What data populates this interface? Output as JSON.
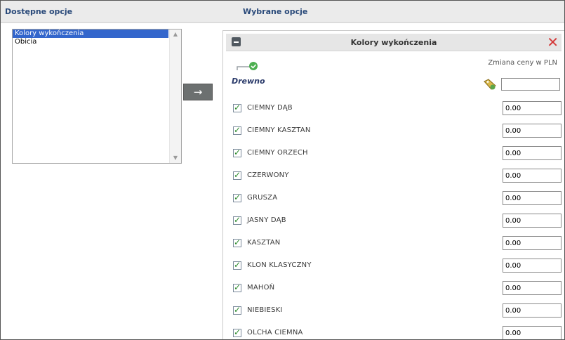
{
  "available": {
    "title": "Dostępne opcje",
    "items": [
      {
        "label": "Kolory wykończenia",
        "selected": true
      },
      {
        "label": "Obicia",
        "selected": false
      }
    ]
  },
  "chosen": {
    "title": "Wybrane opcje"
  },
  "transfer_button": {
    "symbol": "→"
  },
  "panel": {
    "title": "Kolory wykończenia",
    "close_symbol": "✕",
    "price_column_label": "Zmiana ceny w PLN",
    "group": {
      "label": "Drewno",
      "price": ""
    },
    "options": [
      {
        "label": "CIEMNY DĄB",
        "checked": true,
        "price": "0.00"
      },
      {
        "label": "CIEMNY KASZTAN",
        "checked": true,
        "price": "0.00"
      },
      {
        "label": "CIEMNY ORZECH",
        "checked": true,
        "price": "0.00"
      },
      {
        "label": "CZERWONY",
        "checked": true,
        "price": "0.00"
      },
      {
        "label": "GRUSZA",
        "checked": true,
        "price": "0.00"
      },
      {
        "label": "JASNY DĄB",
        "checked": true,
        "price": "0.00"
      },
      {
        "label": "KASZTAN",
        "checked": true,
        "price": "0.00"
      },
      {
        "label": "KLON KLASYCZNY",
        "checked": true,
        "price": "0.00"
      },
      {
        "label": "MAHOŃ",
        "checked": true,
        "price": "0.00"
      },
      {
        "label": "NIEBIESKI",
        "checked": true,
        "price": "0.00"
      },
      {
        "label": "OLCHA CIEMNA",
        "checked": true,
        "price": "0.00"
      }
    ]
  },
  "colors": {
    "accent": "#2a4a7a",
    "selection": "#3366cc",
    "close": "#d43a3a",
    "check": "#2a8a2a"
  }
}
